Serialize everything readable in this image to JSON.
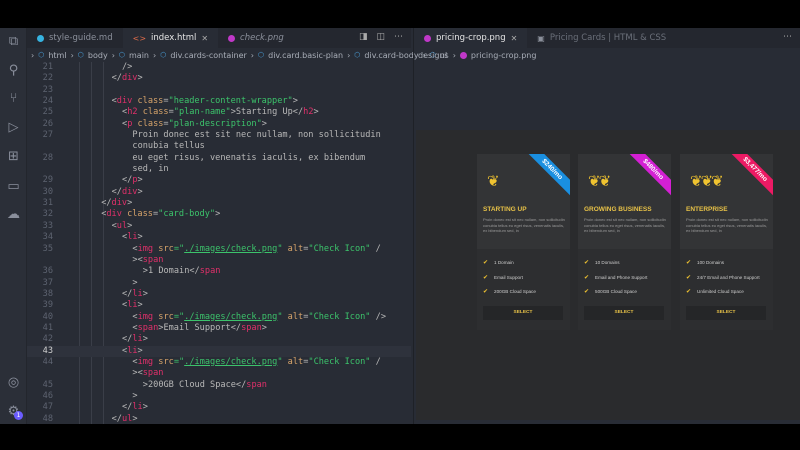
{
  "left_tabs": [
    {
      "label": "style-guide.md",
      "color": "#36b3e0"
    },
    {
      "label": "index.html",
      "color": "#e06c4a",
      "active": true
    },
    {
      "label": "check.png",
      "color": "#c038c8"
    }
  ],
  "breadcrumbs": [
    "html",
    "body",
    "main",
    "div.cards-container",
    "div.card.basic-plan",
    "div.card-body",
    "ul"
  ],
  "right_tabs": [
    {
      "label": "pricing-crop.png",
      "active": true
    },
    {
      "label": "Pricing Cards | HTML & CSS"
    }
  ],
  "right_breadcrumbs": [
    "designs",
    "pricing-crop.png"
  ],
  "activity_badge": "1",
  "current_line": "43",
  "code": [
    {
      "n": "21",
      "i": 10,
      "t": [
        [
          "/>",
          "pu"
        ]
      ]
    },
    {
      "n": "22",
      "i": 8,
      "t": [
        [
          "</",
          "pu"
        ],
        [
          "div",
          "tg"
        ],
        [
          ">",
          "pu"
        ]
      ]
    },
    {
      "n": "23",
      "i": 0,
      "t": []
    },
    {
      "n": "24",
      "i": 8,
      "t": [
        [
          "<",
          "pu"
        ],
        [
          "div",
          "tg"
        ],
        [
          " class",
          "at"
        ],
        [
          "=",
          "pu"
        ],
        [
          "\"header-content-wrapper\"",
          "st"
        ],
        [
          ">",
          "pu"
        ]
      ]
    },
    {
      "n": "25",
      "i": 10,
      "t": [
        [
          "<",
          "pu"
        ],
        [
          "h2",
          "tg"
        ],
        [
          " class",
          "at"
        ],
        [
          "=",
          "pu"
        ],
        [
          "\"plan-name\"",
          "st"
        ],
        [
          ">Starting Up</",
          "pu"
        ],
        [
          "h2",
          "tg"
        ],
        [
          ">",
          "pu"
        ]
      ]
    },
    {
      "n": "26",
      "i": 10,
      "t": [
        [
          "<",
          "pu"
        ],
        [
          "p",
          "tg"
        ],
        [
          " class",
          "at"
        ],
        [
          "=",
          "pu"
        ],
        [
          "\"plan-description\"",
          "st"
        ],
        [
          ">",
          "pu"
        ]
      ]
    },
    {
      "n": "27",
      "i": 12,
      "t": [
        [
          "Proin donec est sit nec nullam, non sollicitudin",
          "pu"
        ]
      ]
    },
    {
      "n": "",
      "i": 12,
      "t": [
        [
          "conubia tellus",
          "pu"
        ]
      ]
    },
    {
      "n": "28",
      "i": 12,
      "t": [
        [
          "eu eget risus, venenatis iaculis, ex bibendum",
          "pu"
        ]
      ]
    },
    {
      "n": "",
      "i": 12,
      "t": [
        [
          "sed, in",
          "pu"
        ]
      ]
    },
    {
      "n": "29",
      "i": 10,
      "t": [
        [
          "</",
          "pu"
        ],
        [
          "p",
          "tg"
        ],
        [
          ">",
          "pu"
        ]
      ]
    },
    {
      "n": "30",
      "i": 8,
      "t": [
        [
          "</",
          "pu"
        ],
        [
          "div",
          "tg"
        ],
        [
          ">",
          "pu"
        ]
      ]
    },
    {
      "n": "31",
      "i": 6,
      "t": [
        [
          "</",
          "pu"
        ],
        [
          "div",
          "tg"
        ],
        [
          ">",
          "pu"
        ]
      ]
    },
    {
      "n": "32",
      "i": 6,
      "t": [
        [
          "<",
          "pu"
        ],
        [
          "div",
          "tg"
        ],
        [
          " class",
          "at"
        ],
        [
          "=",
          "pu"
        ],
        [
          "\"card-body\"",
          "st"
        ],
        [
          ">",
          "pu"
        ]
      ]
    },
    {
      "n": "33",
      "i": 8,
      "t": [
        [
          "<",
          "pu"
        ],
        [
          "ul",
          "tg"
        ],
        [
          ">",
          "pu"
        ]
      ]
    },
    {
      "n": "34",
      "i": 10,
      "t": [
        [
          "<",
          "pu"
        ],
        [
          "li",
          "tg"
        ],
        [
          ">",
          "pu"
        ]
      ]
    },
    {
      "n": "35",
      "i": 12,
      "t": [
        [
          "<",
          "pu"
        ],
        [
          "img",
          "tg"
        ],
        [
          " src",
          "at"
        ],
        [
          "=\"",
          "st"
        ],
        [
          "./images/check.png",
          "u"
        ],
        [
          "\"",
          "st"
        ],
        [
          " alt",
          "at"
        ],
        [
          "=",
          "pu"
        ],
        [
          "\"Check Icon\"",
          "st"
        ],
        [
          " /",
          "pu"
        ]
      ]
    },
    {
      "n": "",
      "i": 12,
      "t": [
        [
          "><",
          "pu"
        ],
        [
          "span",
          "tg"
        ]
      ]
    },
    {
      "n": "36",
      "i": 14,
      "t": [
        [
          ">1 Domain</",
          "pu"
        ],
        [
          "span",
          "tg"
        ]
      ]
    },
    {
      "n": "37",
      "i": 12,
      "t": [
        [
          ">",
          "pu"
        ]
      ]
    },
    {
      "n": "38",
      "i": 10,
      "t": [
        [
          "</",
          "pu"
        ],
        [
          "li",
          "tg"
        ],
        [
          ">",
          "pu"
        ]
      ]
    },
    {
      "n": "39",
      "i": 10,
      "t": [
        [
          "<",
          "pu"
        ],
        [
          "li",
          "tg"
        ],
        [
          ">",
          "pu"
        ]
      ]
    },
    {
      "n": "40",
      "i": 12,
      "t": [
        [
          "<",
          "pu"
        ],
        [
          "img",
          "tg"
        ],
        [
          " src",
          "at"
        ],
        [
          "=\"",
          "st"
        ],
        [
          "./images/check.png",
          "u"
        ],
        [
          "\"",
          "st"
        ],
        [
          " alt",
          "at"
        ],
        [
          "=",
          "pu"
        ],
        [
          "\"Check Icon\"",
          "st"
        ],
        [
          " />",
          "pu"
        ]
      ]
    },
    {
      "n": "41",
      "i": 12,
      "t": [
        [
          "<",
          "pu"
        ],
        [
          "span",
          "tg"
        ],
        [
          ">Email Support</",
          "pu"
        ],
        [
          "span",
          "tg"
        ],
        [
          ">",
          "pu"
        ]
      ]
    },
    {
      "n": "42",
      "i": 10,
      "t": [
        [
          "</",
          "pu"
        ],
        [
          "li",
          "tg"
        ],
        [
          ">",
          "pu"
        ]
      ]
    },
    {
      "n": "43",
      "i": 10,
      "t": [
        [
          "<",
          "pu"
        ],
        [
          "li",
          "tg"
        ],
        [
          ">",
          "pu"
        ]
      ]
    },
    {
      "n": "44",
      "i": 12,
      "t": [
        [
          "<",
          "pu"
        ],
        [
          "img",
          "tg"
        ],
        [
          " src",
          "at"
        ],
        [
          "=\"",
          "st"
        ],
        [
          "./images/check.png",
          "u"
        ],
        [
          "\"",
          "st"
        ],
        [
          " alt",
          "at"
        ],
        [
          "=",
          "pu"
        ],
        [
          "\"Check Icon\"",
          "st"
        ],
        [
          " /",
          "pu"
        ]
      ]
    },
    {
      "n": "",
      "i": 12,
      "t": [
        [
          "><",
          "pu"
        ],
        [
          "span",
          "tg"
        ]
      ]
    },
    {
      "n": "45",
      "i": 14,
      "t": [
        [
          ">200GB Cloud Space</",
          "pu"
        ],
        [
          "span",
          "tg"
        ]
      ]
    },
    {
      "n": "46",
      "i": 12,
      "t": [
        [
          ">",
          "pu"
        ]
      ]
    },
    {
      "n": "47",
      "i": 10,
      "t": [
        [
          "</",
          "pu"
        ],
        [
          "li",
          "tg"
        ],
        [
          ">",
          "pu"
        ]
      ]
    },
    {
      "n": "48",
      "i": 8,
      "t": [
        [
          "</",
          "pu"
        ],
        [
          "ul",
          "tg"
        ],
        [
          ">",
          "pu"
        ]
      ]
    }
  ],
  "cards": [
    {
      "name": "STARTING UP",
      "price": "$240/mo",
      "ribbon": "#1a8fe0",
      "icon": "❦",
      "desc": "Proin donec est sit nec nullam, non sollicitudin conubia tellus eu eget risus, venenatis iaculis, ex bibendum sed, in",
      "features": [
        "1 Domain",
        "Email Support",
        "200GB Cloud Space"
      ],
      "button": "SELECT"
    },
    {
      "name": "GROWING BUSINESS",
      "price": "$480/mo",
      "ribbon": "#d41fd4",
      "icon": "❦❦",
      "desc": "Proin donec est sit nec nullam, non sollicitudin conubia tellus eu eget risus, venenatis iaculis, ex bibendum sed, in",
      "features": [
        "10 Domains",
        "Email and Phone Support",
        "500GB Cloud Space"
      ],
      "button": "SELECT"
    },
    {
      "name": "ENTERPRISE",
      "price": "$3,477/mo",
      "ribbon": "#ec1a64",
      "icon": "❦❦❦",
      "desc": "Proin donec est sit nec nullam, non sollicitudin conubia tellus eu eget risus, venenatis iaculis, ex bibendum sed, in",
      "features": [
        "100 Domains",
        "24/7 Email and Phone Support",
        "Unlimited Cloud Space"
      ],
      "button": "SELECT"
    }
  ]
}
